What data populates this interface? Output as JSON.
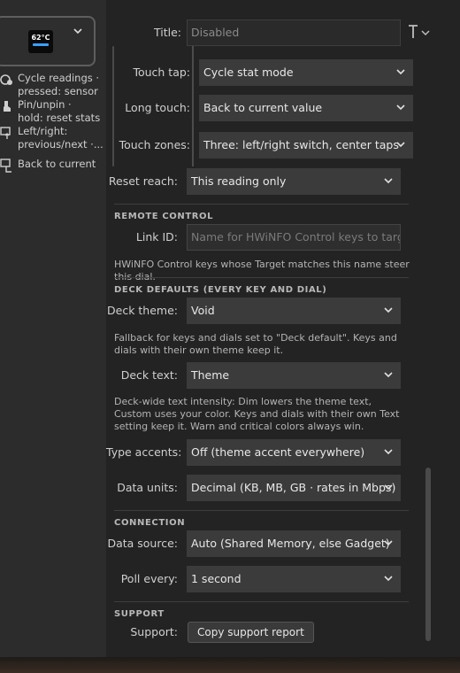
{
  "key_preview": {
    "temp_text": "62°C"
  },
  "left_actions": [
    {
      "icon": "cycle-icon",
      "text": "Cycle readings ·\npressed: sensor"
    },
    {
      "icon": "pin-icon",
      "text": "Pin/unpin ·\nhold: reset stats"
    },
    {
      "icon": "arrows-icon",
      "text": "Left/right:\nprevious/next ·..."
    },
    {
      "icon": "return-icon",
      "text": "Back to current"
    }
  ],
  "title_field": {
    "label": "Title:",
    "value": "Disabled",
    "type_icon": "text-type-icon"
  },
  "touch_tap": {
    "label": "Touch tap:",
    "value": "Cycle stat mode"
  },
  "long_touch": {
    "label": "Long touch:",
    "value": "Back to current value"
  },
  "touch_zones": {
    "label": "Touch zones:",
    "value": "Three: left/right switch, center taps"
  },
  "reset_reach": {
    "label": "Reset reach:",
    "value": "This reading only"
  },
  "remote_control": {
    "heading": "REMOTE CONTROL",
    "link_id_label": "Link ID:",
    "link_id_placeholder": "Name for HWiNFO Control keys to target",
    "help": "HWiNFO Control keys whose Target matches this name steer this dial."
  },
  "deck_defaults": {
    "heading": "DECK DEFAULTS (EVERY KEY AND DIAL)",
    "theme_label": "Deck theme:",
    "theme_value": "Void",
    "theme_help": "Fallback for keys and dials set to \"Deck default\". Keys and dials with their own theme keep it.",
    "text_label": "Deck text:",
    "text_value": "Theme",
    "text_help": "Deck-wide text intensity: Dim lowers the theme text, Custom uses your color. Keys and dials with their own Text setting keep it. Warn and critical colors always win.",
    "accents_label": "Type accents:",
    "accents_value": "Off (theme accent everywhere)",
    "units_label": "Data units:",
    "units_value": "Decimal (KB, MB, GB · rates in Mbps)"
  },
  "connection": {
    "heading": "CONNECTION",
    "source_label": "Data source:",
    "source_value": "Auto (Shared Memory, else Gadget)",
    "poll_label": "Poll every:",
    "poll_value": "1 second"
  },
  "support": {
    "heading": "SUPPORT",
    "label": "Support:",
    "button": "Copy support report"
  },
  "colors": {
    "accent": "#3aa0ff",
    "background": "#232323",
    "control": "#3b3b3b"
  }
}
